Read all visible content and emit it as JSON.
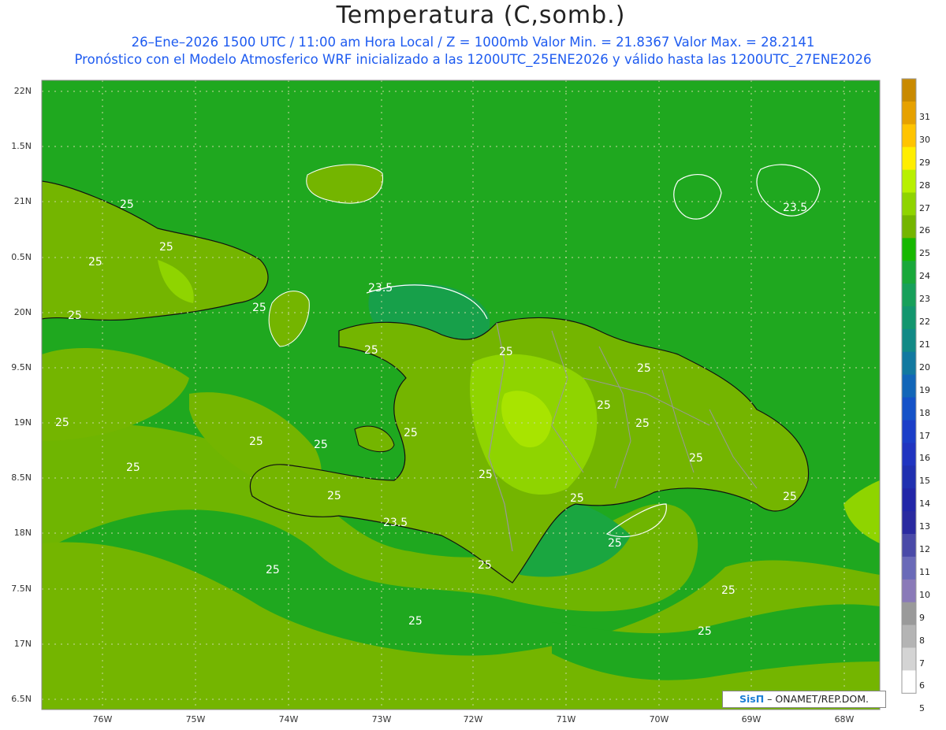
{
  "title": "Temperatura (C,somb.)",
  "subtitle_line1": "26–Ene–2026 1500 UTC / 11:00 am Hora Local / Z = 1000mb   Valor Min. = 21.8367   Valor Max. = 28.2141",
  "subtitle_line2": "Pronóstico con el Modelo Atmosferico WRF inicializado a las 1200UTC_25ENE2026 y válido hasta las  1200UTC_27ENE2026",
  "lat_labels": [
    "22N",
    "1.5N",
    "21N",
    "0.5N",
    "20N",
    "9.5N",
    "19N",
    "8.5N",
    "18N",
    "7.5N",
    "17N",
    "6.5N"
  ],
  "lon_labels": [
    "76W",
    "75W",
    "74W",
    "73W",
    "72W",
    "71W",
    "70W",
    "69W",
    "68W"
  ],
  "colorbar": {
    "labels": [
      "31",
      "30",
      "29",
      "28",
      "27",
      "26",
      "25",
      "24",
      "23",
      "22",
      "21",
      "20",
      "19",
      "18",
      "17",
      "16",
      "15",
      "14",
      "13",
      "12",
      "11",
      "10",
      "9",
      "8",
      "7",
      "6",
      "5"
    ],
    "colors": [
      "#c98a00",
      "#e6a100",
      "#ffc400",
      "#ffee00",
      "#b8f000",
      "#8fd400",
      "#74b500",
      "#17b800",
      "#19a83a",
      "#17a05a",
      "#13966e",
      "#128a86",
      "#1279a0",
      "#1266b8",
      "#1452c8",
      "#1b3ec8",
      "#2034c0",
      "#2030b0",
      "#2226a8",
      "#2a2aa0",
      "#4a4aa8",
      "#6a6ab8",
      "#8a7ab8",
      "#9a9a9a",
      "#b4b4b4",
      "#d4d4d4",
      "#ffffff"
    ]
  },
  "contour_labels": [
    "25",
    "25",
    "25",
    "25",
    "25",
    "23.5",
    "25",
    "25",
    "23.5",
    "25",
    "25",
    "25",
    "25",
    "25",
    "25",
    "25",
    "25",
    "25",
    "25",
    "23.5",
    "25",
    "25",
    "25",
    "25",
    "25",
    "25",
    "25",
    "25",
    "25"
  ],
  "credit": {
    "logo": "SisΠ",
    "text": "– ONAMET/REP.DOM."
  },
  "colors": {
    "ocean": "#1fa81f",
    "land_warm": "#74b500",
    "warm_core": "#9ad600",
    "cool_zone": "#17a040",
    "contour": "#ffffff",
    "coast": "#111111",
    "border": "#999999"
  }
}
